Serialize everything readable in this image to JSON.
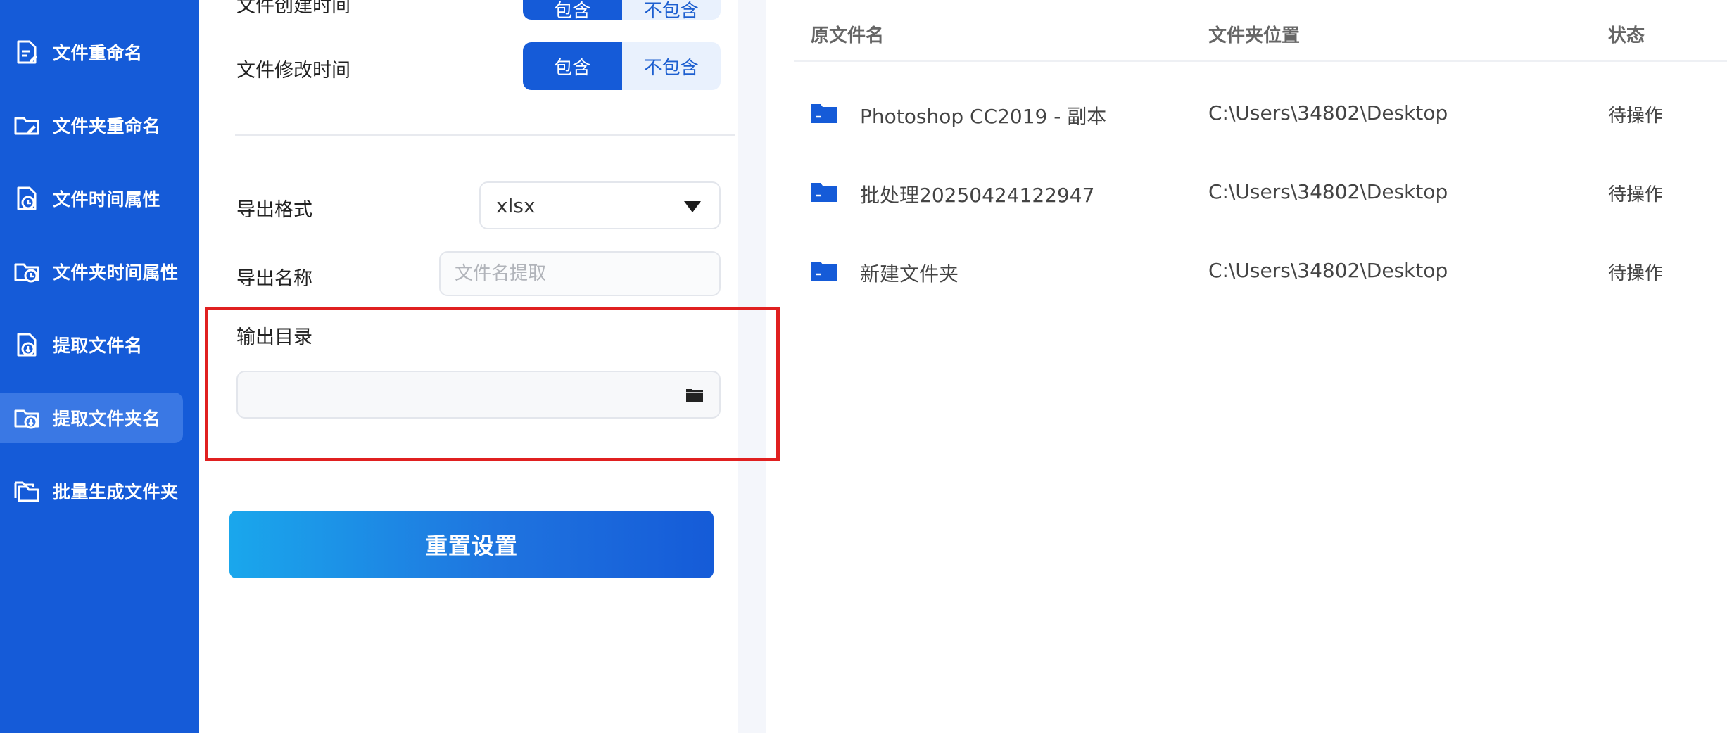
{
  "sidebar": {
    "items": [
      {
        "label": "文件重命名",
        "icon": "file-rename-icon"
      },
      {
        "label": "文件夹重命名",
        "icon": "folder-rename-icon"
      },
      {
        "label": "文件时间属性",
        "icon": "file-time-icon"
      },
      {
        "label": "文件夹时间属性",
        "icon": "folder-time-icon"
      },
      {
        "label": "提取文件名",
        "icon": "extract-file-icon"
      },
      {
        "label": "提取文件夹名",
        "icon": "extract-folder-icon",
        "active": true
      },
      {
        "label": "批量生成文件夹",
        "icon": "batch-folder-icon"
      }
    ]
  },
  "settings": {
    "create_time": {
      "label": "文件创建时间",
      "include": "包含",
      "exclude": "不包含",
      "selected": "包含"
    },
    "modify_time": {
      "label": "文件修改时间",
      "include": "包含",
      "exclude": "不包含",
      "selected": "包含"
    },
    "export_format": {
      "label": "导出格式",
      "value": "xlsx"
    },
    "export_name": {
      "label": "导出名称",
      "placeholder": "文件名提取",
      "value": ""
    },
    "output_dir": {
      "label": "输出目录",
      "value": ""
    },
    "reset_label": "重置设置"
  },
  "table": {
    "headers": {
      "name": "原文件名",
      "location": "文件夹位置",
      "status": "状态"
    },
    "rows": [
      {
        "name": "Photoshop CC2019 - 副本",
        "location": "C:\\Users\\34802\\Desktop",
        "status": "待操作"
      },
      {
        "name": "批处理20250424122947",
        "location": "C:\\Users\\34802\\Desktop",
        "status": "待操作"
      },
      {
        "name": "新建文件夹",
        "location": "C:\\Users\\34802\\Desktop",
        "status": "待操作"
      }
    ]
  },
  "colors": {
    "brand": "#155bd8",
    "sidebar_active": "#3a78e4",
    "highlight": "#e02020",
    "segment_off_bg": "#e9f1fd"
  }
}
